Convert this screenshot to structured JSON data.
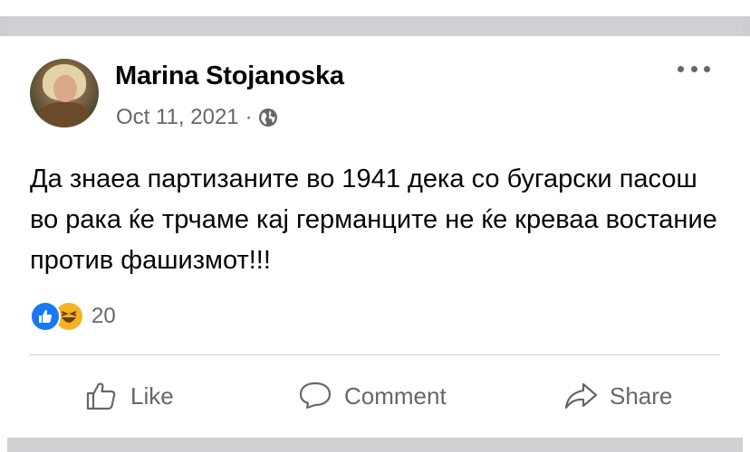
{
  "post": {
    "author": "Marina Stojanoska",
    "date": "Oct 11, 2021",
    "separator": "·",
    "privacy_icon": "globe-icon",
    "text": "Да знаеа партизаните во 1941 дека со бугарски пасош во рака ќе трчаме кај германците не ќе креваа востание против фашизмот!!!",
    "reaction_icons": [
      "like-icon",
      "haha-icon"
    ],
    "reaction_count": "20"
  },
  "actions": {
    "like": "Like",
    "comment": "Comment",
    "share": "Share"
  },
  "colors": {
    "text_primary": "#050505",
    "text_secondary": "#65676b",
    "like_blue": "#1877f2",
    "haha_yellow": "#f7b125",
    "separator_gray": "#ced0d4"
  }
}
